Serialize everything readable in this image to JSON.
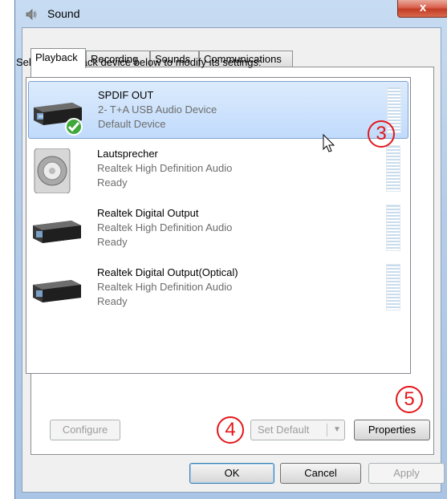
{
  "window": {
    "title": "Sound",
    "close_glyph": "x",
    "title_icon": "speaker-icon"
  },
  "tabs": [
    {
      "label": "Playback",
      "active": true
    },
    {
      "label": "Recording",
      "active": false
    },
    {
      "label": "Sounds",
      "active": false
    },
    {
      "label": "Communications",
      "active": false
    }
  ],
  "instruction": "Select a playback device below to modify its settings:",
  "devices": [
    {
      "name": "SPDIF OUT",
      "description": "2- T+A USB Audio Device",
      "status": "Default Device",
      "selected": true,
      "icon": "digital-output-device-icon",
      "default_badge": true
    },
    {
      "name": "Lautsprecher",
      "description": "Realtek High Definition Audio",
      "status": "Ready",
      "selected": false,
      "icon": "speaker-device-icon"
    },
    {
      "name": "Realtek Digital Output",
      "description": "Realtek High Definition Audio",
      "status": "Ready",
      "selected": false,
      "icon": "digital-output-device-icon"
    },
    {
      "name": "Realtek Digital Output(Optical)",
      "description": "Realtek High Definition Audio",
      "status": "Ready",
      "selected": false,
      "icon": "digital-output-device-icon"
    }
  ],
  "annotations": {
    "three": "3",
    "four": "4",
    "five": "5",
    "color": "#e3171b"
  },
  "buttons": {
    "configure": "Configure",
    "set_default": "Set Default",
    "properties": "Properties",
    "ok": "OK",
    "cancel": "Cancel",
    "apply": "Apply"
  }
}
